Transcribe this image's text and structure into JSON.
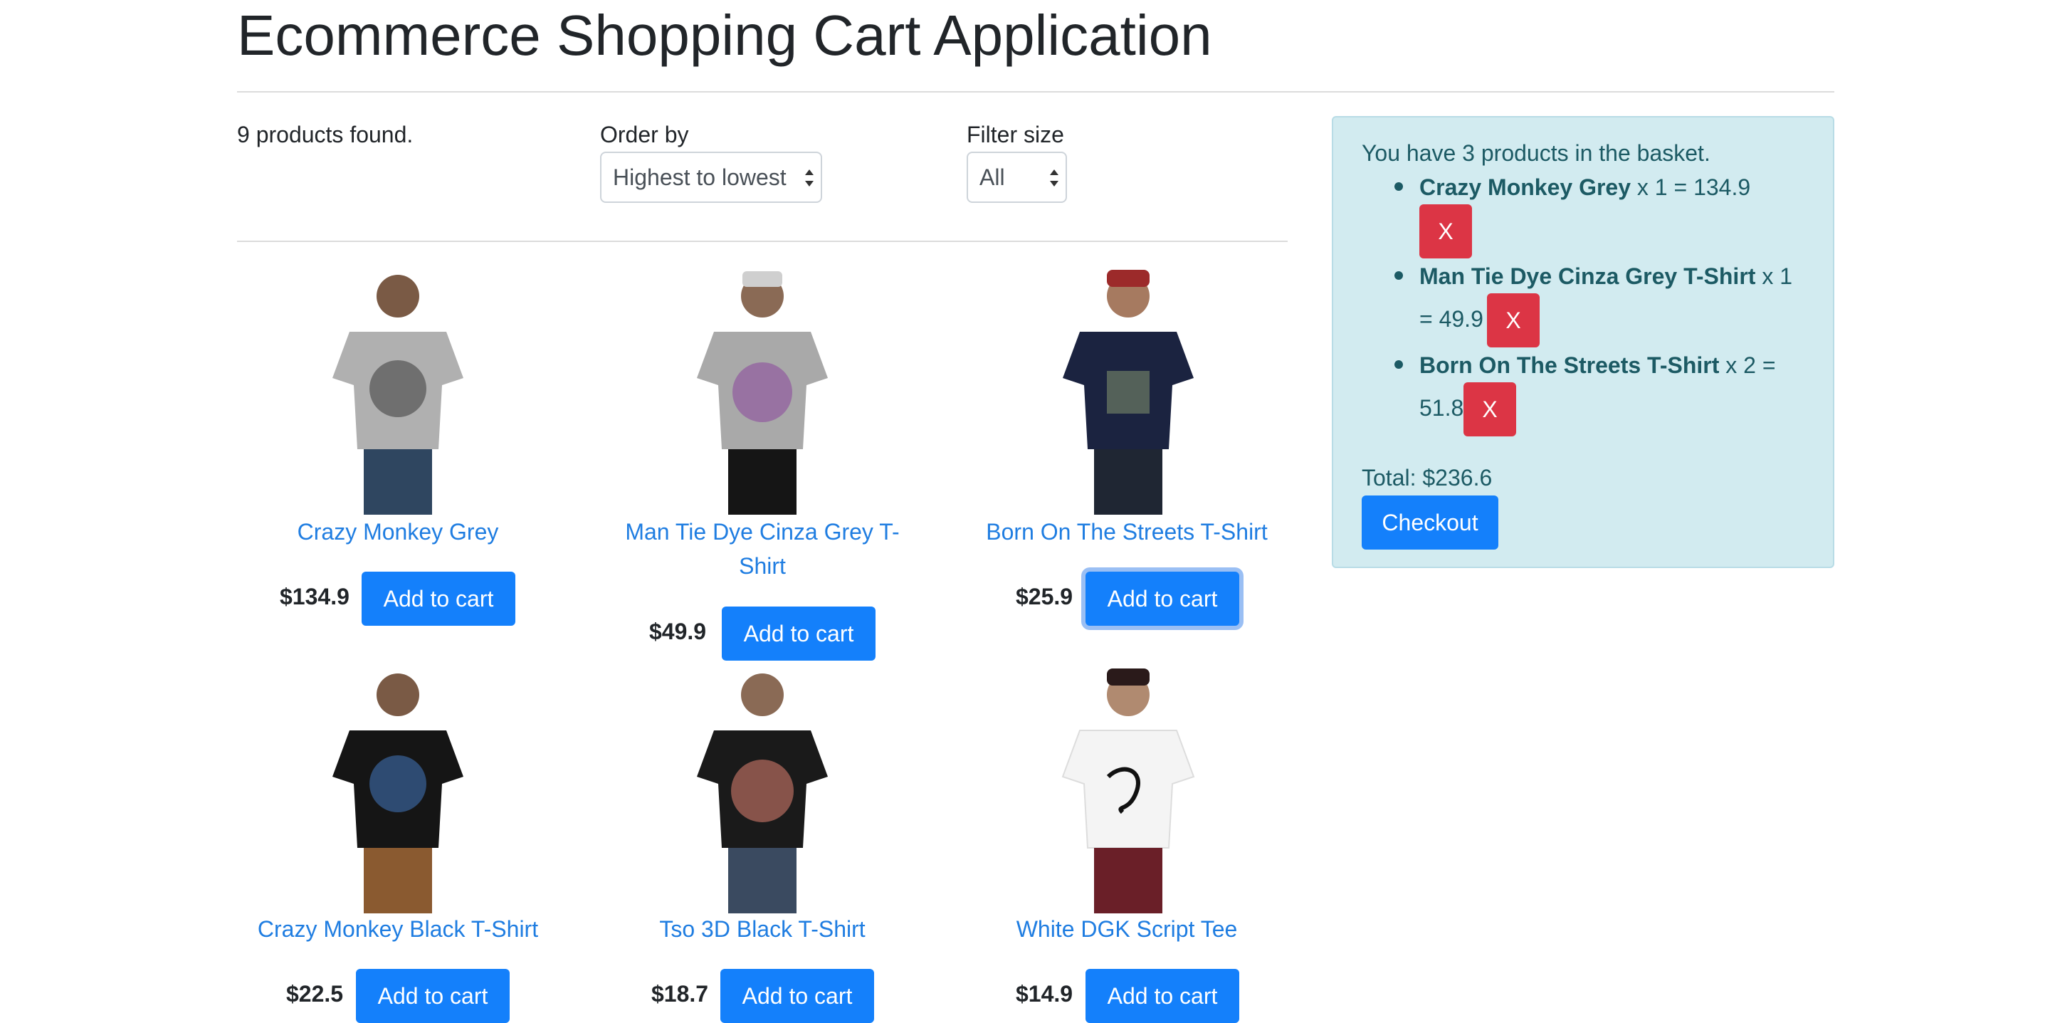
{
  "header": {
    "title": "Ecommerce Shopping Cart Application"
  },
  "shelf": {
    "products_found": "9 products found."
  },
  "controls": {
    "order_by": {
      "label": "Order by",
      "selected": "Highest to lowest"
    },
    "filter_size": {
      "label": "Filter size",
      "selected": "All"
    }
  },
  "products": [
    {
      "name": "Crazy Monkey Grey",
      "price": "$134.9",
      "add_label": "Add to cart",
      "shirt_color": "#b0b0b0"
    },
    {
      "name": "Man Tie Dye Cinza Grey T-Shirt",
      "price": "$49.9",
      "add_label": "Add to cart",
      "shirt_color": "#a9a9a9"
    },
    {
      "name": "Born On The Streets T-Shirt",
      "price": "$25.9",
      "add_label": "Add to cart",
      "shirt_color": "#1b2340"
    },
    {
      "name": "Crazy Monkey Black T-Shirt",
      "price": "$22.5",
      "add_label": "Add to cart",
      "shirt_color": "#151515"
    },
    {
      "name": "Tso 3D Black T-Shirt",
      "price": "$18.7",
      "add_label": "Add to cart",
      "shirt_color": "#1a1a1a"
    },
    {
      "name": "White DGK Script Tee",
      "price": "$14.9",
      "add_label": "Add to cart",
      "shirt_color": "#f4f4f4"
    }
  ],
  "basket": {
    "summary": "You have 3 products in the basket.",
    "items": [
      {
        "name": "Crazy Monkey Grey",
        "qty_line": " x 1 = 134.9",
        "remove_label": "X"
      },
      {
        "name": "Man Tie Dye Cinza Grey T-Shirt",
        "qty_line": " x 1",
        "qty_line_cont": "= 49.9",
        "remove_label": "X"
      },
      {
        "name": "Born On The Streets T-Shirt",
        "qty_line": " x 2 =",
        "qty_line_cont": "51.8",
        "remove_label": "X"
      }
    ],
    "total": "Total: $236.6",
    "checkout_label": "Checkout"
  },
  "colors": {
    "primary": "#1480fb",
    "danger": "#dc3545",
    "link": "#1f7de1",
    "basket_bg": "#d2ebf0"
  }
}
